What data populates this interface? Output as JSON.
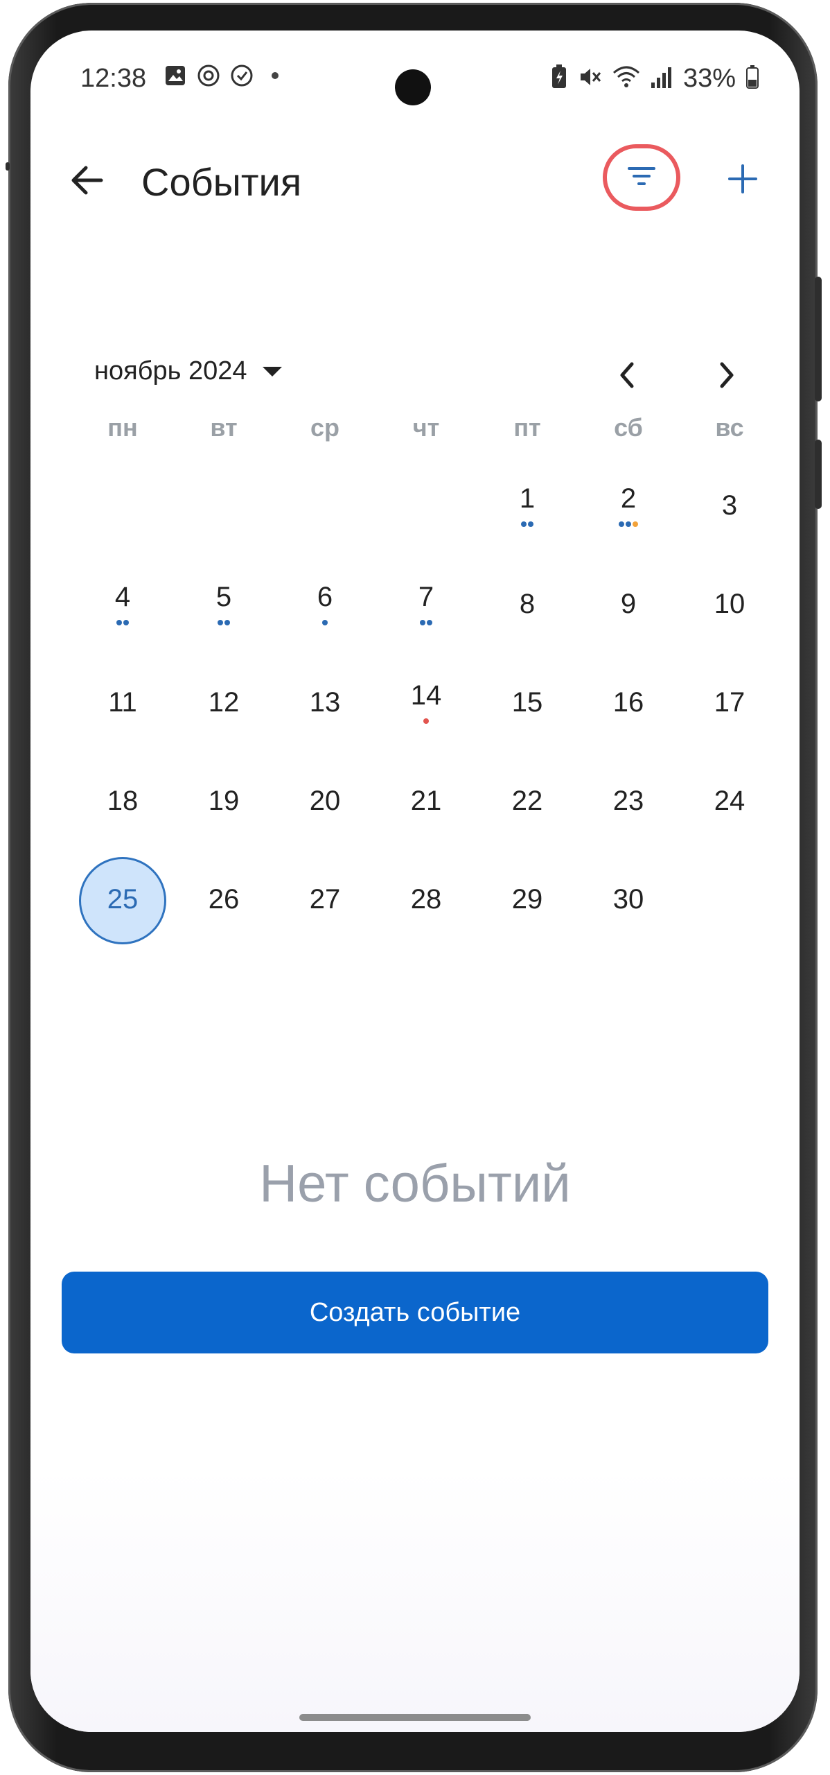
{
  "status_bar": {
    "time": "12:38",
    "battery": "33%"
  },
  "app_bar": {
    "title": "События"
  },
  "calendar": {
    "month_label": "ноябрь 2024",
    "weekdays": [
      "пн",
      "вт",
      "ср",
      "чт",
      "пт",
      "сб",
      "вс"
    ],
    "selected_day": "25",
    "weeks": [
      [
        {
          "day": ""
        },
        {
          "day": ""
        },
        {
          "day": ""
        },
        {
          "day": ""
        },
        {
          "day": "1",
          "marks": [
            "#2b6ab3",
            "#2b6ab3"
          ]
        },
        {
          "day": "2",
          "marks": [
            "#2b6ab3",
            "#2b6ab3",
            "#f2a23a"
          ]
        },
        {
          "day": "3"
        }
      ],
      [
        {
          "day": "4",
          "marks": [
            "#2b6ab3",
            "#2b6ab3"
          ]
        },
        {
          "day": "5",
          "marks": [
            "#2b6ab3",
            "#2b6ab3"
          ]
        },
        {
          "day": "6",
          "marks": [
            "#2b6ab3"
          ]
        },
        {
          "day": "7",
          "marks": [
            "#2b6ab3",
            "#2b6ab3"
          ]
        },
        {
          "day": "8"
        },
        {
          "day": "9"
        },
        {
          "day": "10"
        }
      ],
      [
        {
          "day": "11"
        },
        {
          "day": "12"
        },
        {
          "day": "13"
        },
        {
          "day": "14",
          "marks": [
            "#e2554f"
          ]
        },
        {
          "day": "15"
        },
        {
          "day": "16"
        },
        {
          "day": "17"
        }
      ],
      [
        {
          "day": "18"
        },
        {
          "day": "19"
        },
        {
          "day": "20"
        },
        {
          "day": "21"
        },
        {
          "day": "22"
        },
        {
          "day": "23"
        },
        {
          "day": "24"
        }
      ],
      [
        {
          "day": "25"
        },
        {
          "day": "26"
        },
        {
          "day": "27"
        },
        {
          "day": "28"
        },
        {
          "day": "29"
        },
        {
          "day": "30"
        },
        {
          "day": ""
        }
      ]
    ]
  },
  "empty_state": {
    "text": "Нет событий",
    "create_button": "Создать событие"
  },
  "colors": {
    "primary": "#0b66cc",
    "selected_fill": "#cfe4fb",
    "filter_highlight": "#ea5a5e"
  }
}
